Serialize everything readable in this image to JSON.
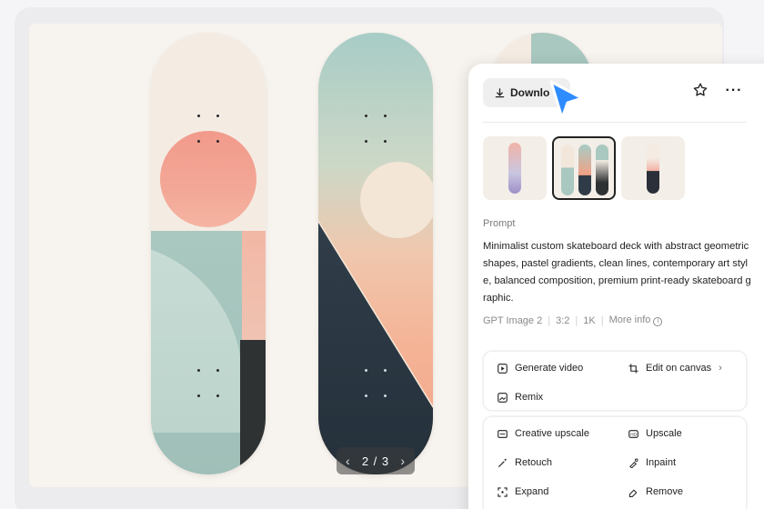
{
  "preview": {
    "pager_prev": "‹",
    "pager_label": "2 / 3",
    "pager_next": "›"
  },
  "panel": {
    "download_label": "Downlo",
    "more_label": "···",
    "prompt_label": "Prompt",
    "prompt_text": "Minimalist custom skateboard deck with abstract geometric shapes, pastel gradients, clean lines, contemporary art style, balanced composition, premium print-ready skateboard graphic.",
    "meta": {
      "model": "GPT Image 2",
      "ratio": "3:2",
      "resolution": "1K",
      "more_info": "More info"
    },
    "actions_primary": [
      {
        "label": "Generate video",
        "icon": "play-box-icon"
      },
      {
        "label": "Edit on canvas",
        "icon": "crop-icon",
        "suffix": "›"
      },
      {
        "label": "Remix",
        "icon": "image-remix-icon"
      }
    ],
    "actions_secondary": [
      {
        "label": "Creative upscale",
        "icon": "creative-upscale-icon"
      },
      {
        "label": "Upscale",
        "icon": "upscale-icon"
      },
      {
        "label": "Retouch",
        "icon": "magic-wand-icon"
      },
      {
        "label": "Inpaint",
        "icon": "inpaint-icon"
      },
      {
        "label": "Expand",
        "icon": "expand-icon"
      },
      {
        "label": "Remove",
        "icon": "eraser-icon"
      }
    ]
  },
  "colors": {
    "accent_cursor": "#2f8cff",
    "panel_bg": "#ffffff",
    "stage_bg": "#f7f3ee"
  }
}
